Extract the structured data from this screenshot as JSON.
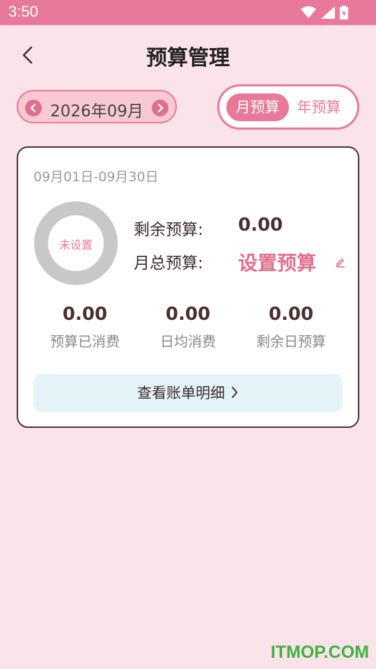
{
  "status_bar": {
    "time": "3:50"
  },
  "header": {
    "title": "预算管理"
  },
  "month_selector": {
    "label": "2026年09月"
  },
  "tabs": [
    {
      "label": "月预算",
      "active": true
    },
    {
      "label": "年预算",
      "active": false
    }
  ],
  "card": {
    "date_range": "09月01日-09月30日",
    "ring_label": "未设置",
    "remaining_label": "剩余预算:",
    "remaining_value": "0.00",
    "total_label": "月总预算:",
    "set_budget_label": "设置预算",
    "stats": [
      {
        "value": "0.00",
        "label": "预算已消费"
      },
      {
        "value": "0.00",
        "label": "日均消费"
      },
      {
        "value": "0.00",
        "label": "剩余日预算"
      }
    ],
    "detail_button": "查看账单明细"
  },
  "watermark": "ITMOP.COM",
  "colors": {
    "accent": "#e8799a",
    "background": "#fbe3ea",
    "ring": "#c8c8c8",
    "detail_button_bg": "#e3f3f8",
    "watermark": "#3fb23f"
  },
  "icons": [
    "wifi-icon",
    "signal-icon",
    "battery-icon",
    "back-arrow-icon",
    "chevron-left-icon",
    "chevron-right-icon",
    "edit-icon"
  ]
}
